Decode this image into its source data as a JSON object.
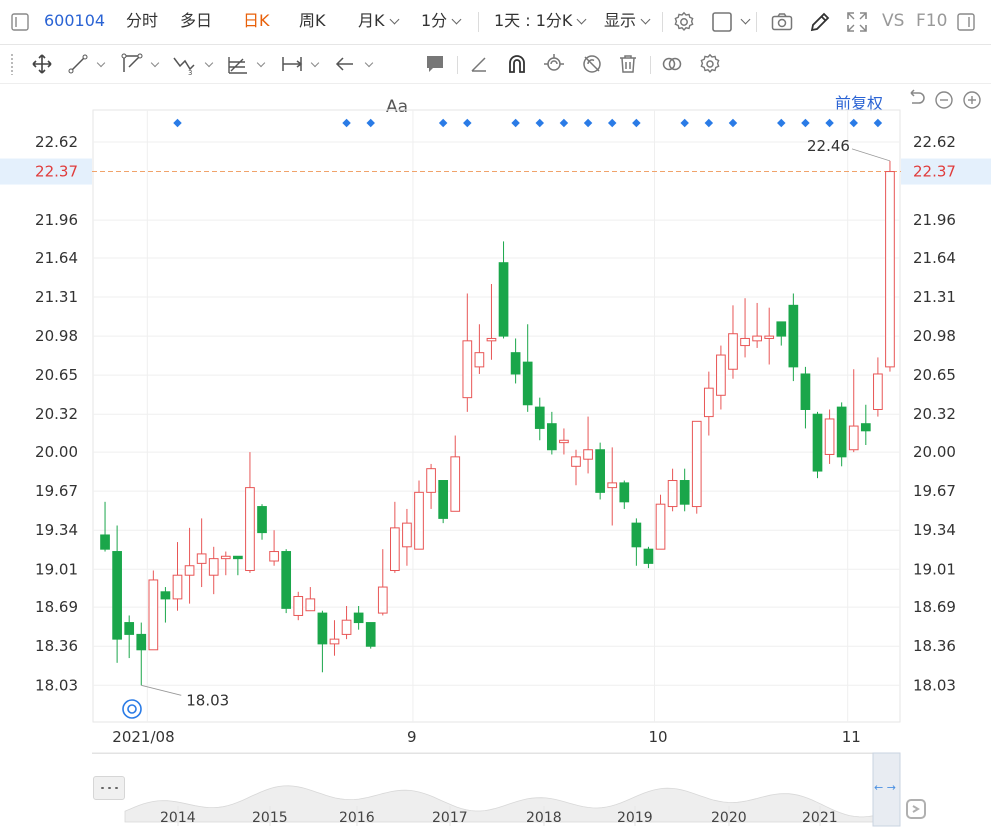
{
  "toolbar": {
    "stock_code": "600104",
    "tabs": [
      {
        "label": "分时",
        "active": false
      },
      {
        "label": "多日",
        "active": false
      },
      {
        "label": "日K",
        "active": true
      },
      {
        "label": "周K",
        "active": false
      },
      {
        "label": "月K",
        "active": false,
        "dropdown": true
      },
      {
        "label": "1分",
        "active": false,
        "dropdown": true
      }
    ],
    "combo_label": "1天 : 1分K",
    "display_label": "显示",
    "vs_label": "VS",
    "f10_label": "F10",
    "active_color": "#e8600a",
    "link_color": "#2a63d4"
  },
  "drawing_tools": {
    "icons": [
      "move-icon",
      "line-icon",
      "polyline-icon",
      "wave-icon",
      "fib-icon",
      "measure-icon",
      "arrow-icon",
      "text-icon",
      "note-icon",
      "pen-icon",
      "magnet-icon",
      "lock-icon",
      "hide-icon",
      "trash-icon",
      "link-icon",
      "settings-icon"
    ],
    "text_tool_label": "Aa"
  },
  "price_adjust_label": "前复权",
  "chart_data": {
    "type": "candlestick",
    "title": "",
    "yticks": [
      "22.62",
      "21.96",
      "21.64",
      "21.31",
      "20.98",
      "20.65",
      "20.32",
      "20.00",
      "19.67",
      "19.34",
      "19.01",
      "18.69",
      "18.36",
      "18.03"
    ],
    "ylim": [
      17.72,
      22.89
    ],
    "xticks": [
      {
        "label": "2021/08",
        "index": 4
      },
      {
        "label": "9",
        "index": 26
      },
      {
        "label": "10",
        "index": 46
      },
      {
        "label": "11",
        "index": 62
      }
    ],
    "crosshair_price": "22.37",
    "max_label": "22.46",
    "min_label": "18.03",
    "colors": {
      "up": "#e85656",
      "down": "#1aa64a",
      "dashed": "#f0a36b",
      "marker": "#2a7be6",
      "highlight_bg": "#e4f0fc",
      "highlight_text": "#e03c3c"
    },
    "candles": [
      {
        "o": 19.3,
        "c": 19.18,
        "h": 19.58,
        "l": 19.16
      },
      {
        "o": 19.16,
        "c": 18.42,
        "h": 19.38,
        "l": 18.22
      },
      {
        "o": 18.56,
        "c": 18.46,
        "h": 18.62,
        "l": 18.26
      },
      {
        "o": 18.46,
        "c": 18.33,
        "h": 18.56,
        "l": 18.03
      },
      {
        "o": 18.33,
        "c": 18.92,
        "h": 19.0,
        "l": 18.33
      },
      {
        "o": 18.82,
        "c": 18.76,
        "h": 18.86,
        "l": 18.56
      },
      {
        "o": 18.76,
        "c": 18.96,
        "h": 19.24,
        "l": 18.66
      },
      {
        "o": 18.96,
        "c": 19.04,
        "h": 19.36,
        "l": 18.72
      },
      {
        "o": 19.06,
        "c": 19.14,
        "h": 19.44,
        "l": 18.86
      },
      {
        "o": 18.96,
        "c": 19.1,
        "h": 19.2,
        "l": 18.8
      },
      {
        "o": 19.1,
        "c": 19.12,
        "h": 19.16,
        "l": 18.96
      },
      {
        "o": 19.12,
        "c": 19.1,
        "h": 19.12,
        "l": 18.96
      },
      {
        "o": 19.0,
        "c": 19.7,
        "h": 20.0,
        "l": 18.98
      },
      {
        "o": 19.54,
        "c": 19.32,
        "h": 19.56,
        "l": 19.26
      },
      {
        "o": 19.08,
        "c": 19.16,
        "h": 19.34,
        "l": 19.04
      },
      {
        "o": 19.16,
        "c": 18.68,
        "h": 19.18,
        "l": 18.64
      },
      {
        "o": 18.62,
        "c": 18.78,
        "h": 18.82,
        "l": 18.58
      },
      {
        "o": 18.66,
        "c": 18.76,
        "h": 18.86,
        "l": 18.66
      },
      {
        "o": 18.64,
        "c": 18.38,
        "h": 18.66,
        "l": 18.14
      },
      {
        "o": 18.38,
        "c": 18.42,
        "h": 18.58,
        "l": 18.28
      },
      {
        "o": 18.46,
        "c": 18.58,
        "h": 18.7,
        "l": 18.42
      },
      {
        "o": 18.64,
        "c": 18.56,
        "h": 18.7,
        "l": 18.5
      },
      {
        "o": 18.56,
        "c": 18.36,
        "h": 18.56,
        "l": 18.34
      },
      {
        "o": 18.64,
        "c": 18.86,
        "h": 19.18,
        "l": 18.62
      },
      {
        "o": 19.0,
        "c": 19.36,
        "h": 19.58,
        "l": 18.98
      },
      {
        "o": 19.2,
        "c": 19.4,
        "h": 19.52,
        "l": 19.04
      },
      {
        "o": 19.18,
        "c": 19.66,
        "h": 19.76,
        "l": 19.18
      },
      {
        "o": 19.66,
        "c": 19.86,
        "h": 19.9,
        "l": 19.52
      },
      {
        "o": 19.76,
        "c": 19.44,
        "h": 19.76,
        "l": 19.4
      },
      {
        "o": 19.5,
        "c": 19.96,
        "h": 20.14,
        "l": 19.5
      },
      {
        "o": 20.46,
        "c": 20.94,
        "h": 21.34,
        "l": 20.34
      },
      {
        "o": 20.72,
        "c": 20.84,
        "h": 21.08,
        "l": 20.66
      },
      {
        "o": 20.94,
        "c": 20.96,
        "h": 21.42,
        "l": 20.78
      },
      {
        "o": 21.6,
        "c": 20.98,
        "h": 21.78,
        "l": 20.96
      },
      {
        "o": 20.84,
        "c": 20.66,
        "h": 20.96,
        "l": 20.58
      },
      {
        "o": 20.76,
        "c": 20.4,
        "h": 21.08,
        "l": 20.34
      },
      {
        "o": 20.38,
        "c": 20.2,
        "h": 20.46,
        "l": 20.1
      },
      {
        "o": 20.24,
        "c": 20.02,
        "h": 20.34,
        "l": 19.98
      },
      {
        "o": 20.08,
        "c": 20.1,
        "h": 20.2,
        "l": 19.98
      },
      {
        "o": 19.88,
        "c": 19.96,
        "h": 20.02,
        "l": 19.72
      },
      {
        "o": 19.94,
        "c": 20.02,
        "h": 20.3,
        "l": 19.82
      },
      {
        "o": 20.02,
        "c": 19.66,
        "h": 20.08,
        "l": 19.6
      },
      {
        "o": 19.7,
        "c": 19.74,
        "h": 20.04,
        "l": 19.38
      },
      {
        "o": 19.74,
        "c": 19.58,
        "h": 19.76,
        "l": 19.52
      },
      {
        "o": 19.4,
        "c": 19.2,
        "h": 19.44,
        "l": 19.04
      },
      {
        "o": 19.18,
        "c": 19.06,
        "h": 19.2,
        "l": 19.02
      },
      {
        "o": 19.18,
        "c": 19.56,
        "h": 19.64,
        "l": 19.18
      },
      {
        "o": 19.54,
        "c": 19.76,
        "h": 19.86,
        "l": 19.5
      },
      {
        "o": 19.76,
        "c": 19.56,
        "h": 19.86,
        "l": 19.5
      },
      {
        "o": 19.54,
        "c": 20.26,
        "h": 20.26,
        "l": 19.48
      },
      {
        "o": 20.3,
        "c": 20.54,
        "h": 20.68,
        "l": 20.14
      },
      {
        "o": 20.48,
        "c": 20.82,
        "h": 20.9,
        "l": 20.36
      },
      {
        "o": 20.7,
        "c": 21.0,
        "h": 21.24,
        "l": 20.62
      },
      {
        "o": 20.9,
        "c": 20.96,
        "h": 21.3,
        "l": 20.8
      },
      {
        "o": 20.94,
        "c": 20.98,
        "h": 21.26,
        "l": 20.88
      },
      {
        "o": 20.96,
        "c": 20.98,
        "h": 21.22,
        "l": 20.74
      },
      {
        "o": 21.1,
        "c": 20.98,
        "h": 21.1,
        "l": 20.9
      },
      {
        "o": 21.24,
        "c": 20.72,
        "h": 21.34,
        "l": 20.6
      },
      {
        "o": 20.66,
        "c": 20.36,
        "h": 20.72,
        "l": 20.2
      },
      {
        "o": 20.32,
        "c": 19.84,
        "h": 20.34,
        "l": 19.78
      },
      {
        "o": 19.98,
        "c": 20.28,
        "h": 20.36,
        "l": 19.9
      },
      {
        "o": 20.38,
        "c": 19.96,
        "h": 20.42,
        "l": 19.88
      },
      {
        "o": 20.02,
        "c": 20.22,
        "h": 20.7,
        "l": 20.0
      },
      {
        "o": 20.24,
        "c": 20.18,
        "h": 20.4,
        "l": 20.06
      },
      {
        "o": 20.36,
        "c": 20.66,
        "h": 20.8,
        "l": 20.3
      },
      {
        "o": 20.72,
        "c": 22.37,
        "h": 22.46,
        "l": 20.68
      }
    ],
    "markers": [
      3,
      10,
      11,
      14,
      15,
      17,
      18,
      19,
      20,
      21,
      22,
      24,
      25,
      26,
      28,
      29,
      30,
      31,
      32
    ],
    "navigator": {
      "years": [
        "2014",
        "2015",
        "2016",
        "2017",
        "2018",
        "2019",
        "2020",
        "2021"
      ]
    }
  }
}
